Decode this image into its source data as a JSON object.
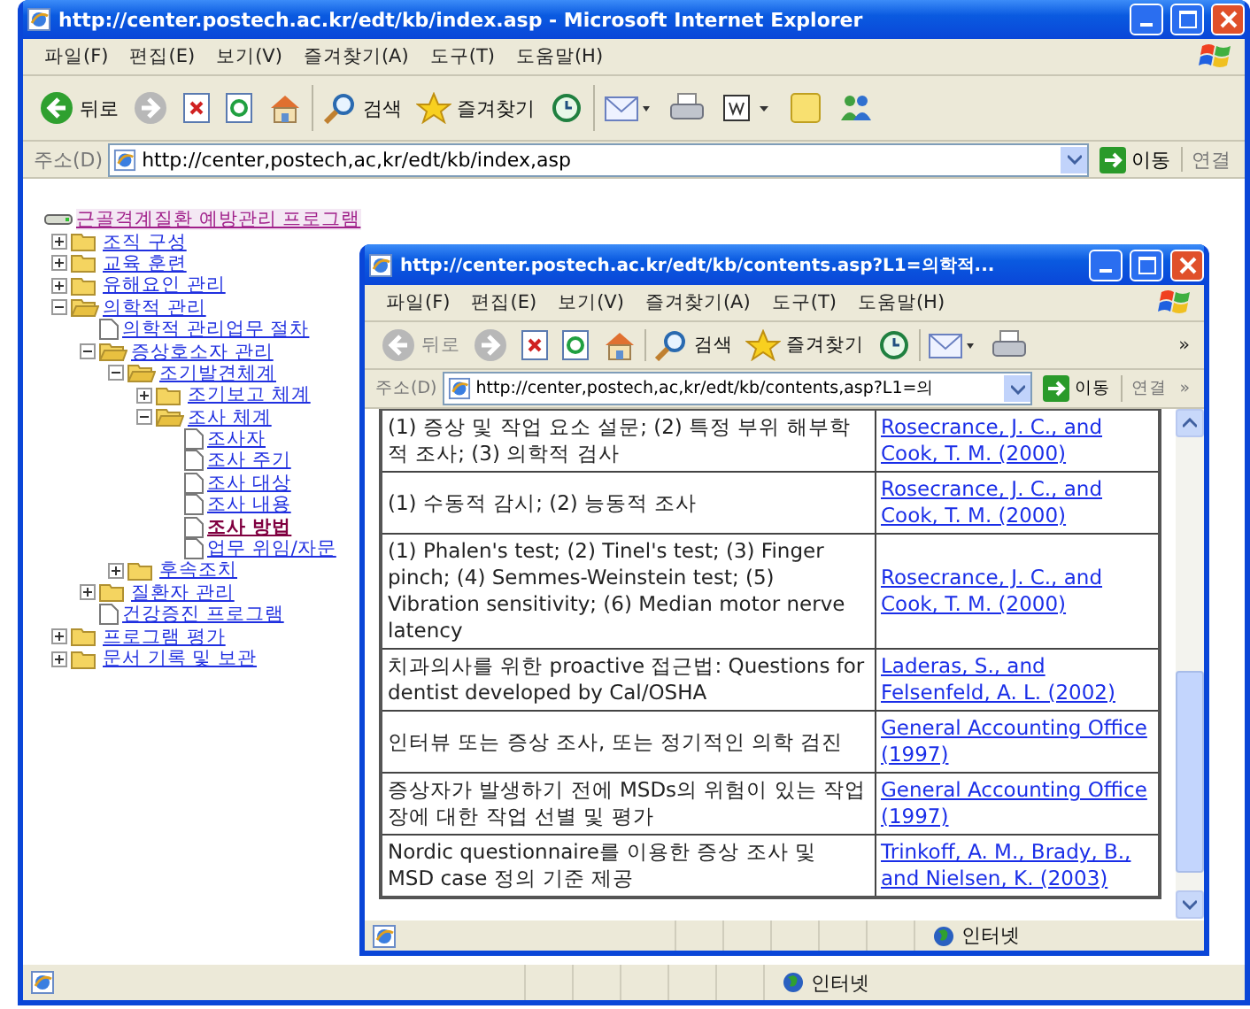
{
  "outer": {
    "title": "http://center.postech.ac.kr/edt/kb/index.asp - Microsoft Internet Explorer",
    "menu": [
      "파일(F)",
      "편집(E)",
      "보기(V)",
      "즐겨찾기(A)",
      "도구(T)",
      "도움말(H)"
    ],
    "toolbar": [
      {
        "kind": "back",
        "label": "뒤로",
        "disabled": false
      },
      {
        "kind": "forward",
        "disabled": true
      },
      {
        "kind": "stop"
      },
      {
        "kind": "refresh"
      },
      {
        "kind": "home"
      },
      {
        "kind": "search",
        "label": "검색"
      },
      {
        "kind": "favorites",
        "label": "즐겨찾기"
      },
      {
        "kind": "history"
      },
      {
        "kind": "mail"
      },
      {
        "kind": "print"
      },
      {
        "kind": "word"
      },
      {
        "kind": "notes"
      },
      {
        "kind": "messenger"
      }
    ],
    "address": {
      "label": "주소(D)",
      "value": "http://center,postech,ac,kr/edt/kb/index,asp",
      "go": "이동",
      "links": "연결"
    },
    "tree": {
      "label": "근골격계질환 예방관리 프로그램",
      "kind": "root",
      "children": [
        {
          "label": "조직 구성",
          "kind": "folder",
          "expanded": false,
          "selected": false
        },
        {
          "label": "교육 훈련",
          "kind": "folder",
          "expanded": false,
          "selected": false
        },
        {
          "label": "유해요인 관리",
          "kind": "folder",
          "expanded": false,
          "selected": false
        },
        {
          "label": "의학적 관리",
          "kind": "folder",
          "expanded": true,
          "selected": false,
          "children": [
            {
              "label": "의학적 관리업무 절차",
              "kind": "page",
              "selected": false
            },
            {
              "label": "증상호소자 관리",
              "kind": "folder",
              "expanded": true,
              "selected": false,
              "children": [
                {
                  "label": "조기발견체계",
                  "kind": "folder",
                  "expanded": true,
                  "selected": false,
                  "children": [
                    {
                      "label": "조기보고 체계",
                      "kind": "folder",
                      "expanded": false,
                      "selected": false
                    },
                    {
                      "label": "조사 체계",
                      "kind": "folder",
                      "expanded": true,
                      "selected": false,
                      "children": [
                        {
                          "label": "조사자",
                          "kind": "page",
                          "selected": false
                        },
                        {
                          "label": "조사 주기",
                          "kind": "page",
                          "selected": false
                        },
                        {
                          "label": "조사 대상",
                          "kind": "page",
                          "selected": false
                        },
                        {
                          "label": "조사 내용",
                          "kind": "page",
                          "selected": false
                        },
                        {
                          "label": "조사 방법",
                          "kind": "page",
                          "selected": true
                        },
                        {
                          "label": "업무 위임/자문",
                          "kind": "page",
                          "selected": false
                        }
                      ]
                    }
                  ]
                },
                {
                  "label": "후속조치",
                  "kind": "folder",
                  "expanded": false,
                  "selected": false
                }
              ]
            },
            {
              "label": "질환자 관리",
              "kind": "folder",
              "expanded": false,
              "selected": false
            },
            {
              "label": "건강증진 프로그램",
              "kind": "page",
              "selected": false
            }
          ]
        },
        {
          "label": "프로그램 평가",
          "kind": "folder",
          "expanded": false,
          "selected": false
        },
        {
          "label": "문서 기록 및 보관",
          "kind": "folder",
          "expanded": false,
          "selected": false
        }
      ]
    },
    "status": "인터넷"
  },
  "inner": {
    "title": "http://center.postech.ac.kr/edt/kb/contents.asp?L1=의학적...",
    "menu": [
      "파일(F)",
      "편집(E)",
      "보기(V)",
      "즐겨찾기(A)",
      "도구(T)",
      "도움말(H)"
    ],
    "toolbar": [
      {
        "kind": "back",
        "label": "뒤로",
        "disabled": true
      },
      {
        "kind": "forward",
        "disabled": true
      },
      {
        "kind": "stop"
      },
      {
        "kind": "refresh"
      },
      {
        "kind": "home"
      },
      {
        "kind": "search",
        "label": "검색"
      },
      {
        "kind": "favorites",
        "label": "즐겨찾기"
      },
      {
        "kind": "history"
      },
      {
        "kind": "mail"
      },
      {
        "kind": "print"
      }
    ],
    "more": "»",
    "address": {
      "label": "주소(D)",
      "value": "http://center,postech,ac,kr/edt/kb/contents,asp?L1=의",
      "go": "이동",
      "links": "연결",
      "more": "»"
    },
    "rows": [
      {
        "description": "(1) 증상 및 작업 요소 설문; (2) 특정 부위 해부학적 조사; (3) 의학적 검사",
        "source": "Rosecrance, J. C., and Cook, T. M. (2000)"
      },
      {
        "description": "(1) 수동적 감시; (2) 능동적 조사",
        "source": "Rosecrance, J. C., and Cook, T. M. (2000)"
      },
      {
        "description": "(1) Phalen's test; (2) Tinel's test; (3) Finger pinch; (4) Semmes-Weinstein test; (5) Vibration sensitivity; (6) Median motor nerve latency",
        "source": "Rosecrance, J. C., and Cook, T. M. (2000)"
      },
      {
        "description": "치과의사를 위한 proactive 접근법: Questions for dentist developed by Cal/OSHA",
        "source": "Laderas, S., and Felsenfeld, A. L. (2002)"
      },
      {
        "description": "인터뷰 또는 증상 조사, 또는 정기적인 의학 검진",
        "source": "General Accounting Office (1997)"
      },
      {
        "description": "증상자가 발생하기 전에 MSDs의 위험이 있는 작업장에 대한 작업 선별 및 평가",
        "source": "General Accounting Office (1997)"
      },
      {
        "description": "Nordic questionnaire를 이용한 증상 조사 및 MSD case 정의 기준 제공",
        "source": "Trinkoff, A. M., Brady, B., and Nielsen, K. (2003)"
      }
    ],
    "status": "인터넷"
  }
}
